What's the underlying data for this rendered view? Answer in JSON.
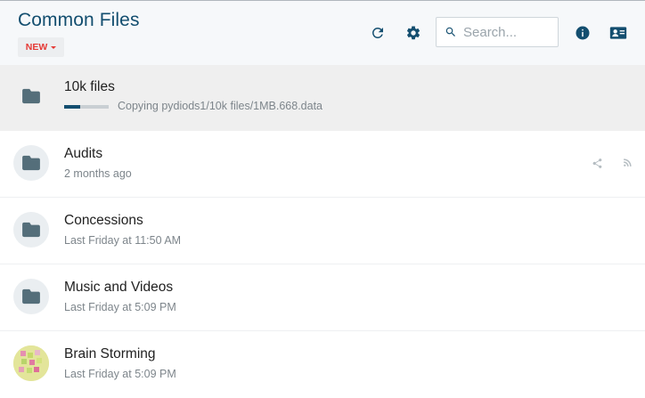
{
  "header": {
    "title": "Common Files",
    "new_label": "NEW",
    "refresh_icon": "refresh-icon",
    "settings_icon": "gear-icon",
    "search_placeholder": "Search...",
    "info_icon": "info-icon",
    "contact_icon": "contact-card-icon"
  },
  "colors": {
    "title": "#134e6f",
    "accent": "#134e6f",
    "new_label": "#e53935",
    "folder_icon": "#546e7a"
  },
  "files": [
    {
      "name": "10k files",
      "status": "Copying pydiods1/10k files/1MB.668.data",
      "progress": 0.36,
      "active": true,
      "icon": "folder-icon"
    },
    {
      "name": "Audits",
      "meta": "2 months ago",
      "icon": "folder-icon",
      "actions": [
        "share-icon",
        "rss-icon"
      ]
    },
    {
      "name": "Concessions",
      "meta": "Last Friday at 11:50 AM",
      "icon": "folder-icon"
    },
    {
      "name": "Music and Videos",
      "meta": "Last Friday at 5:09 PM",
      "icon": "folder-icon"
    },
    {
      "name": "Brain Storming",
      "meta": "Last Friday at 5:09 PM",
      "icon": "image-thumbnail"
    }
  ]
}
